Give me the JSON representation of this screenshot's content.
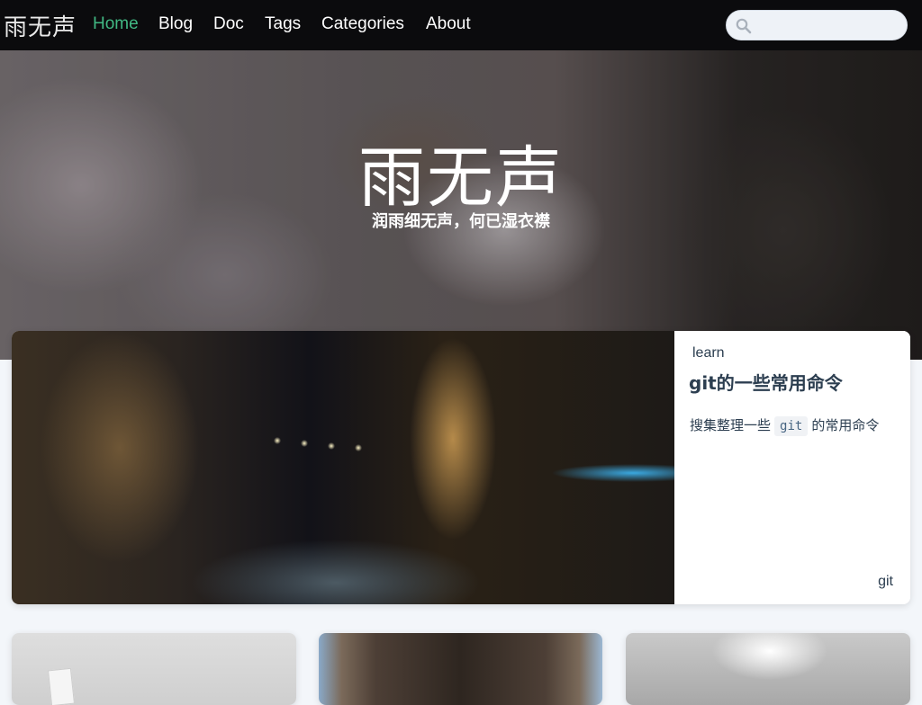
{
  "navbar": {
    "brand": "雨无声",
    "links": [
      {
        "label": "Home",
        "active": true
      },
      {
        "label": "Blog",
        "active": false
      },
      {
        "label": "Doc",
        "active": false
      },
      {
        "label": "Tags",
        "active": false
      },
      {
        "label": "Categories",
        "active": false
      },
      {
        "label": "About",
        "active": false
      }
    ],
    "search": {
      "placeholder": "",
      "value": "",
      "icon": "search-icon"
    }
  },
  "hero": {
    "title": "雨无声",
    "subtitle": "润雨细无声，何已湿衣襟"
  },
  "featured_post": {
    "category": "learn",
    "title": "git的一些常用命令",
    "excerpt_before": "搜集整理一些",
    "excerpt_code": "git",
    "excerpt_after": "的常用命令",
    "tag": "git"
  },
  "colors": {
    "accent": "#41b883",
    "text": "#2c3e50",
    "navbar_bg": "#0b0b0d",
    "page_bg": "#f3f6fa"
  }
}
